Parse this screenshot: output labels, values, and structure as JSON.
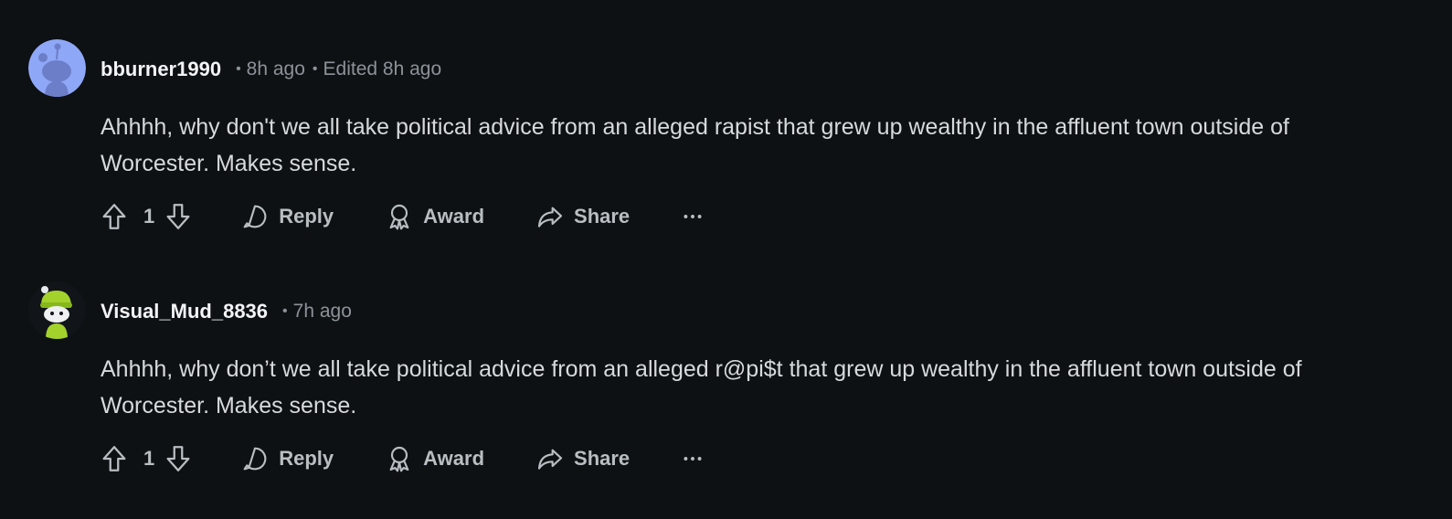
{
  "comments": [
    {
      "username": "bburner1990",
      "time": "8h ago",
      "edited": "Edited 8h ago",
      "body": "Ahhhh, why don't we all take political advice from an alleged rapist that grew up wealthy in the affluent town outside of Worcester. Makes sense.",
      "score": "1",
      "reply_label": "Reply",
      "award_label": "Award",
      "share_label": "Share",
      "avatar_color": "#8fa7f7"
    },
    {
      "username": "Visual_Mud_8836",
      "time": "7h ago",
      "body": "Ahhhh, why don’t we all take political advice from an alleged r@pi$t that grew up wealthy in the affluent town outside of Worcester. Makes sense.",
      "score": "1",
      "reply_label": "Reply",
      "award_label": "Award",
      "share_label": "Share",
      "avatar_color": "#111418"
    }
  ],
  "colors": {
    "background": "#0e1113",
    "text": "#d7dadc",
    "muted": "#8b9399",
    "action": "#b8bec2"
  }
}
